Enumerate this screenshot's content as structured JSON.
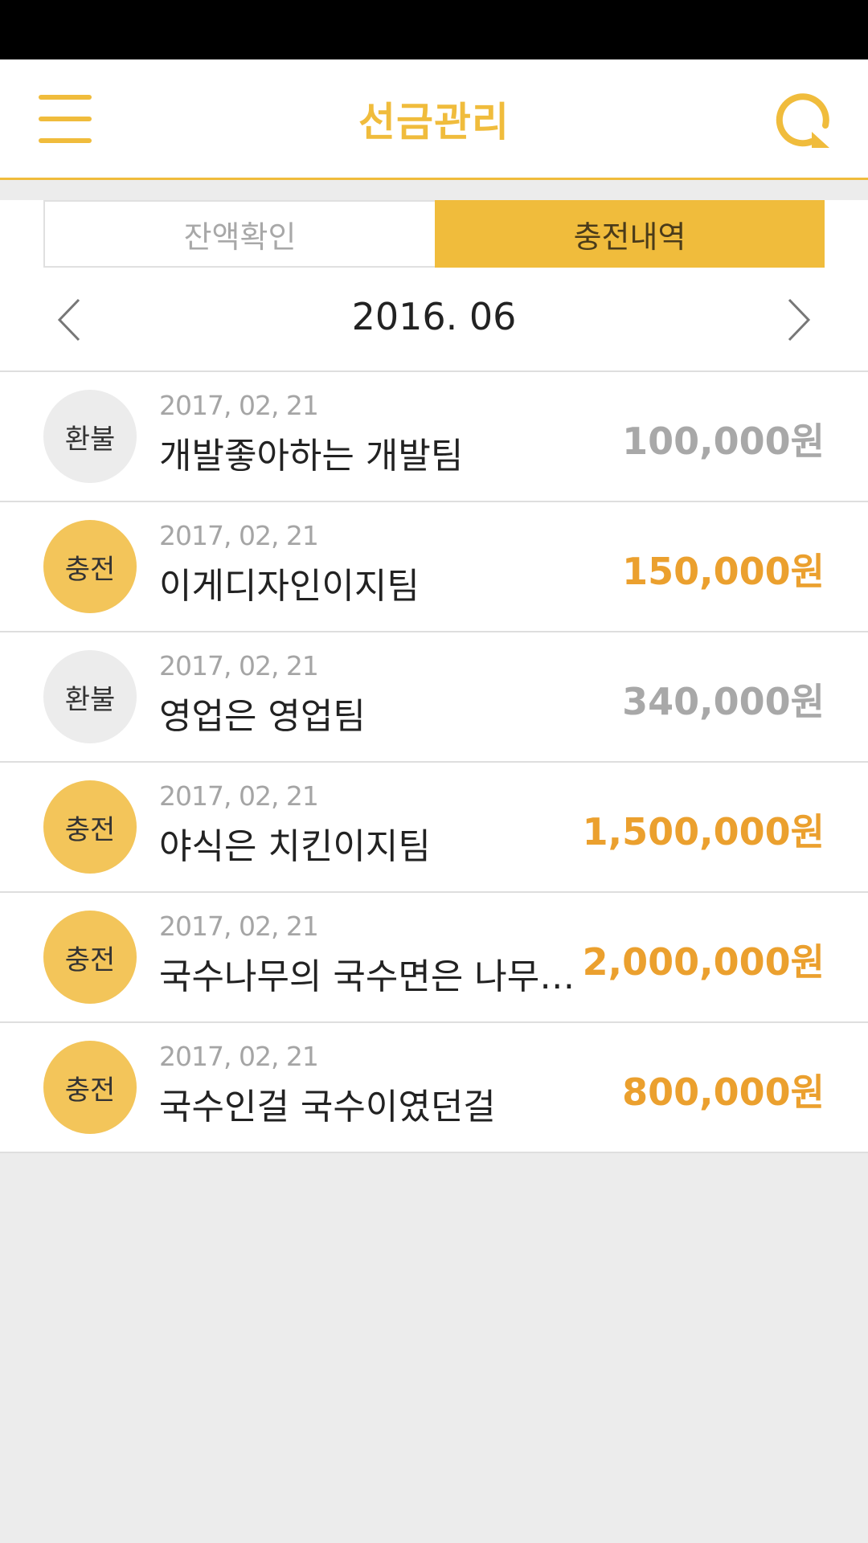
{
  "header": {
    "title": "선금관리",
    "menu_icon": "hamburger-menu-icon",
    "refresh_icon": "refresh-icon"
  },
  "tabs": [
    {
      "label": "잔액확인",
      "active": false
    },
    {
      "label": "충전내역",
      "active": true
    }
  ],
  "month_nav": {
    "label": "2016. 06",
    "prev_icon": "chevron-left-icon",
    "next_icon": "chevron-right-icon"
  },
  "items": [
    {
      "badge": "환불",
      "type": "refund",
      "date": "2017, 02, 21",
      "name": "개발좋아하는 개발팀",
      "amount": "100,000원"
    },
    {
      "badge": "충전",
      "type": "charge",
      "date": "2017, 02, 21",
      "name": "이게디자인이지팀",
      "amount": "150,000원"
    },
    {
      "badge": "환불",
      "type": "refund",
      "date": "2017, 02, 21",
      "name": "영업은 영업팀",
      "amount": "340,000원"
    },
    {
      "badge": "충전",
      "type": "charge",
      "date": "2017, 02, 21",
      "name": "야식은 치킨이지팀",
      "amount": "1,500,000원"
    },
    {
      "badge": "충전",
      "type": "charge",
      "date": "2017, 02, 21",
      "name": "국수나무의 국수면은 나무에...",
      "amount": "2,000,000원"
    },
    {
      "badge": "충전",
      "type": "charge",
      "date": "2017, 02, 21",
      "name": "국수인걸 국수이였던걸",
      "amount": "800,000원"
    }
  ],
  "colors": {
    "accent": "#f0bc3c",
    "charge_badge": "#f3c55a",
    "refund_badge": "#ececec",
    "charge_amount": "#eba02e",
    "refund_amount": "#a8a8a8"
  }
}
